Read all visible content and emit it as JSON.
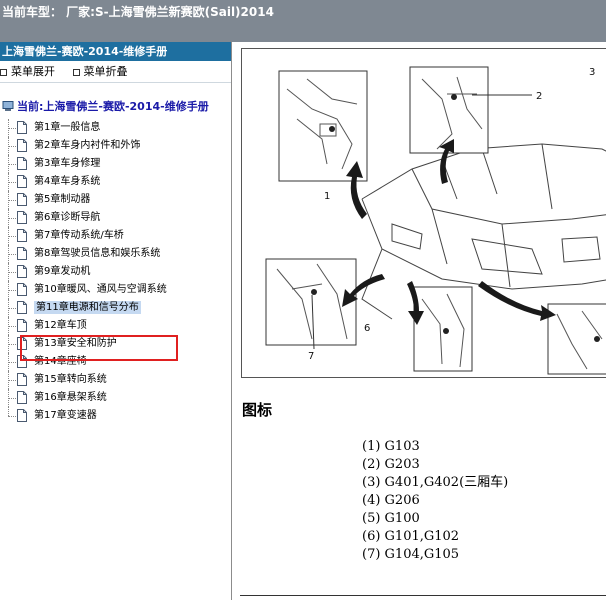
{
  "header": {
    "title": "当前车型：  厂家:S-上海雪佛兰新赛欧(Sail)2014"
  },
  "sidebar": {
    "head": "上海雪佛兰-赛欧-2014-维修手册",
    "expand_label": "菜单展开",
    "collapse_label": "菜单折叠",
    "root_label": "当前:上海雪佛兰-赛欧-2014-维修手册",
    "items": [
      "第1章一般信息",
      "第2章车身内衬件和外饰",
      "第3章车身修理",
      "第4章车身系统",
      "第5章制动器",
      "第6章诊断导航",
      "第7章传动系统/车桥",
      "第8章驾驶员信息和娱乐系统",
      "第9章发动机",
      "第10章暖风、通风与空调系统",
      "第11章电源和信号分布",
      "第12章车顶",
      "第13章安全和防护",
      "第14章座椅",
      "第15章转向系统",
      "第16章悬架系统",
      "第17章变速器"
    ],
    "selected_index": 10
  },
  "figure": {
    "callouts": [
      "1",
      "2",
      "3",
      "6",
      "7"
    ]
  },
  "legend": {
    "title": "图标",
    "entries": [
      "(1) G103",
      "(2) G203",
      "(3) G401,G402(三厢车)",
      "(4) G206",
      "(5) G100",
      "(6) G101,G102",
      "(7) G104,G105"
    ]
  },
  "colors": {
    "topbar": "#7f8892",
    "sidebar_head": "#1e6fa0",
    "highlight_box": "#e02020",
    "root_text": "#1a1aa8"
  }
}
